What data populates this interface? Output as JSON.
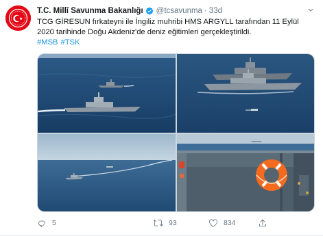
{
  "tweet": {
    "author_name": "T.C. Millî Savunma Bakanlığı",
    "handle": "@tcsavunma",
    "separator": "·",
    "time": "33d",
    "text_line1": "TCG GİRESUN fırkateyni ile İngiliz muhribi HMS ARGYLL tarafından 11 Eylül",
    "text_line2": "2020 tarihinde Doğu Akdeniz'de deniz eğitimleri gerçekleştirildi.",
    "hashtags": [
      "#MSB",
      "#TSK"
    ],
    "stats": {
      "replies": "5",
      "retweets": "93",
      "likes": "834"
    }
  },
  "colors": {
    "link": "#1b95e0",
    "secondary_text": "#657786",
    "avatar_red": "#e30a17",
    "verified": "#1da1f2"
  },
  "icons": [
    "verified-badge-icon",
    "chevron-down-icon",
    "reply-icon",
    "retweet-icon",
    "like-icon",
    "share-icon"
  ]
}
